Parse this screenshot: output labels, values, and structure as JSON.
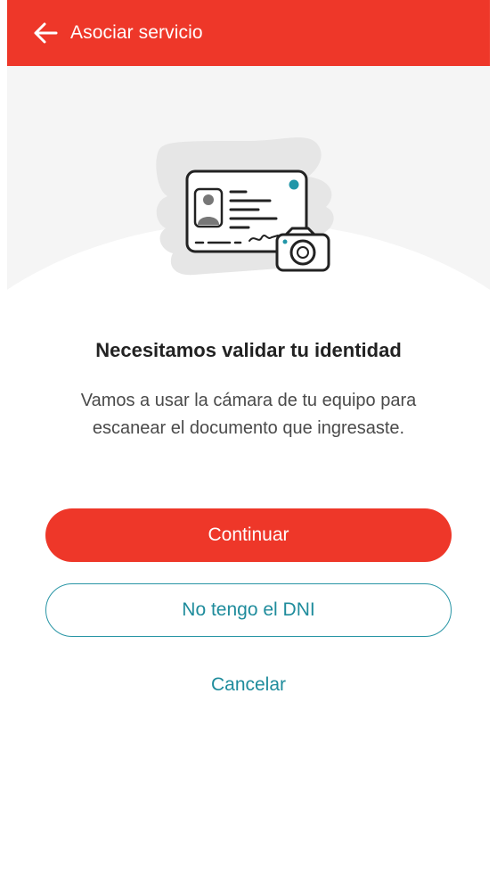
{
  "header": {
    "title": "Asociar servicio",
    "background_color": "#ee3729",
    "back_icon": "arrow-left-icon"
  },
  "illustration": {
    "icon": "id-card-camera-icon",
    "accent_color": "#2196a8"
  },
  "content": {
    "title": "Necesitamos validar tu identidad",
    "description": "Vamos a usar la cámara de tu equipo para escanear el documento que ingresaste."
  },
  "actions": {
    "continue_label": "Continuar",
    "no_dni_label": "No tengo el DNI",
    "cancel_label": "Cancelar",
    "primary_color": "#ee3729",
    "secondary_color": "#1f8c9c"
  }
}
